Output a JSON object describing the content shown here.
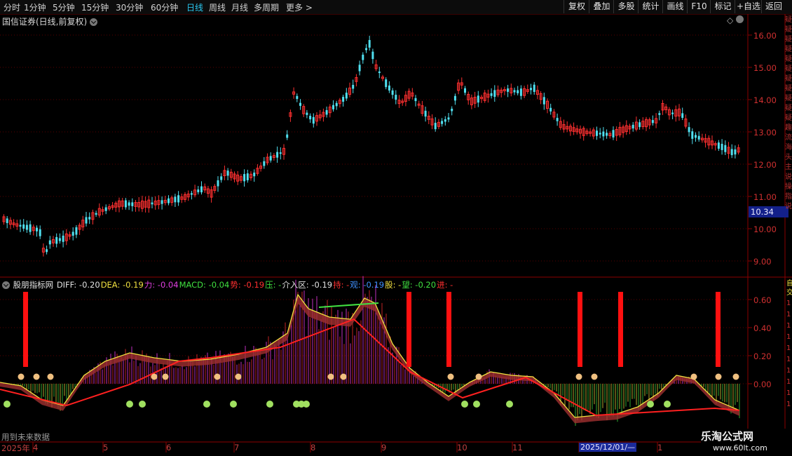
{
  "toolbar": {
    "tabs": [
      {
        "label": "分时"
      },
      {
        "label": "1分钟"
      },
      {
        "label": "5分钟"
      },
      {
        "label": "15分钟"
      },
      {
        "label": "30分钟"
      },
      {
        "label": "60分钟"
      },
      {
        "label": "日线"
      },
      {
        "label": "周线"
      },
      {
        "label": "月线"
      },
      {
        "label": "多周期"
      },
      {
        "label": "更多 >"
      }
    ],
    "active_tab": "日线",
    "right_buttons": [
      {
        "label": "复权"
      },
      {
        "label": "叠加"
      },
      {
        "label": "多股"
      },
      {
        "label": "统计"
      },
      {
        "label": "画线"
      },
      {
        "label": "F10"
      },
      {
        "label": "标记"
      },
      {
        "label": "+自选"
      },
      {
        "label": "返回"
      }
    ]
  },
  "chart": {
    "title": "国信证券(日线,前复权)",
    "price_ticks": [
      "16.00",
      "15.00",
      "14.00",
      "13.00",
      "12.00",
      "11.00",
      "10.00",
      "9.00"
    ],
    "current_price": "10.34",
    "indicator_ticks": [
      "0.60",
      "0.40",
      "0.20",
      "0.00"
    ],
    "indicator_side_ticks": [
      "1",
      "1",
      "1",
      "1",
      "1",
      "1",
      "1",
      "1",
      "1",
      "1"
    ],
    "side_text": "疑疑疑疑疑疑疑疑疑疑疑趣流海头主说操指说",
    "side_text_2": "自交",
    "indicator": {
      "name": "股朋指标网",
      "items": [
        {
          "label": "DIFF: -0.20",
          "color": "#e0e0e0"
        },
        {
          "label": "DEA: -0.19",
          "color": "#f0e040"
        },
        {
          "label": "力: -0.04",
          "color": "#e040e0"
        },
        {
          "label": "MACD: -0.04",
          "color": "#40e040"
        },
        {
          "label": "势: -0.19",
          "color": "#ff3030"
        },
        {
          "label": "压: -",
          "color": "#40e040"
        },
        {
          "label": "介入区: -0.19",
          "color": "#e0e0e0"
        },
        {
          "label": "持: -",
          "color": "#ff3030"
        },
        {
          "label": "观: -0.19",
          "color": "#4090ff"
        },
        {
          "label": "股: -",
          "color": "#f0e040"
        },
        {
          "label": "望: -0.20",
          "color": "#40e040"
        },
        {
          "label": "进: -",
          "color": "#ff3030"
        }
      ]
    },
    "footer_note": "用到未来数据",
    "x_axis": [
      {
        "label": "2025年"
      },
      {
        "label": "4"
      },
      {
        "label": "5"
      },
      {
        "label": "6"
      },
      {
        "label": "7"
      },
      {
        "label": "8"
      },
      {
        "label": "9"
      },
      {
        "label": "10"
      },
      {
        "label": "11"
      },
      {
        "label": "1"
      }
    ],
    "range_label": "2025/12/01/—"
  },
  "watermark": {
    "line1": "乐淘公式网",
    "line2": "www.60lt.com"
  },
  "colors": {
    "up": "#ff3030",
    "down": "#50e0f0",
    "grid": "#5a0000",
    "axis": "#8b0000"
  }
}
